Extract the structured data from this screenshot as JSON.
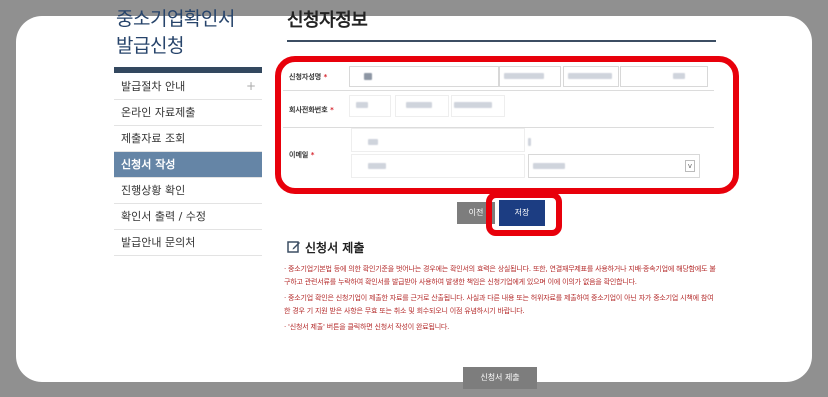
{
  "sidebar": {
    "title": "중소기업확인서\n발급신청",
    "items": [
      {
        "label": "발급절차 안내"
      },
      {
        "label": "온라인 자료제출"
      },
      {
        "label": "제출자료 조회"
      },
      {
        "label": "신청서 작성"
      },
      {
        "label": "진행상황 확인"
      },
      {
        "label": "확인서 출력 / 수정"
      },
      {
        "label": "발급안내 문의처"
      }
    ],
    "expand_symbol": "+"
  },
  "main": {
    "title": "신청자정보",
    "fields": [
      {
        "label": "신청자성명",
        "required": "*"
      },
      {
        "label": "회사전화번호",
        "required": "*"
      },
      {
        "label": "이메일",
        "required": "*"
      }
    ],
    "email_select_arrow": "v",
    "prev_label": "이전",
    "save_label": "저장",
    "section_title": "신청서 제출",
    "notes": [
      "· 중소기업기본법 등에 의한 확인기준을 벗어나는 경우에는 확인서의 효력은 상실됩니다. 또한, 연결재무제표를 사용하거나 지배·종속기업에 해당함에도 불구하고 관련서류를 누락하여 확인서를 발급받아 사용하여 발생한 책임은 신청기업에게 있으며 이에 이의가 없음을 확인합니다.",
      "· 중소기업 확인은 신청기업이 제출한 자료를 근거로 산출됩니다. 사실과 다른 내용 또는 허위자료를 제출하여 중소기업이 아닌 자가 중소기업 시책에 참여한 경우 기 지원 받은 사항은 무효 또는 취소 및 회수되오니 이점 유념하시기 바랍니다.",
      "· '신청서 제출' 버튼을 클릭하면 신청서 작성이 완료됩니다."
    ],
    "submit_label": "신청서 제출"
  },
  "colors": {
    "highlight": "#e8000b",
    "save_button": "#1c3d82",
    "active_menu": "#6585a6",
    "note_text": "#b42b2b"
  }
}
